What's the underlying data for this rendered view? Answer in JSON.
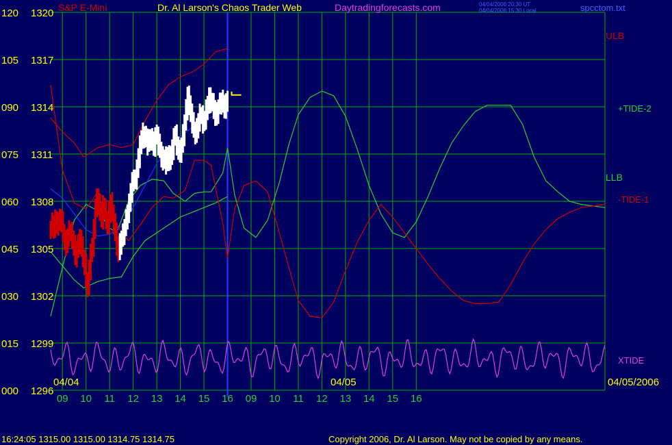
{
  "header": {
    "symbol": "S&P E-Mini",
    "title": "Dr. Al Larson's Chaos Trader Web",
    "site": "Daytradingforecasts.com",
    "timestamp_ut": "04/04/2006 20:30 UT",
    "timestamp_local": "04/04/2006 15:30 Local",
    "filename": "spcctom.txt"
  },
  "footer": {
    "quote": "16:24:05  1315.00 1315.00 1314.75 1314.75",
    "copyright": "Copyright 2006, Dr. Al Larson. May not be copied by any means."
  },
  "date_labels": {
    "left": "04/04",
    "middle": "04/05",
    "right": "04/05/2006"
  },
  "colors": {
    "background": "#000060",
    "grid": "#00b000",
    "yellow": "#ffff00",
    "red": "#d00000",
    "green": "#30d030",
    "magenta": "#e040e0",
    "blue": "#2030ff",
    "white": "#ffffff",
    "cursor": "#2040ff"
  },
  "chart_data": {
    "type": "line",
    "title": "S&P E-Mini",
    "ylim_price": [
      1296,
      1320
    ],
    "ylim_index": [
      0,
      120
    ],
    "y_ticks": [
      {
        "index": "000",
        "price": "1296"
      },
      {
        "index": "015",
        "price": "1299"
      },
      {
        "index": "030",
        "price": "1302"
      },
      {
        "index": "045",
        "price": "1305"
      },
      {
        "index": "060",
        "price": "1308"
      },
      {
        "index": "075",
        "price": "1311"
      },
      {
        "index": "090",
        "price": "1314"
      },
      {
        "index": "105",
        "price": "1317"
      },
      {
        "index": "120",
        "price": "1320"
      }
    ],
    "x_ticks": [
      "09",
      "10",
      "11",
      "12",
      "13",
      "14",
      "15",
      "16",
      "09",
      "10",
      "11",
      "12",
      "13",
      "14",
      "15",
      "16"
    ],
    "x_range": [
      8.5,
      32
    ],
    "series_labels": [
      "ULB",
      "+TIDE-2",
      "LLB",
      "-TIDE-1",
      "XTIDE"
    ],
    "series": [
      {
        "name": "ULB",
        "color": "red",
        "x": [
          8.5,
          9,
          9.5,
          9.9,
          10.5,
          11,
          11.5,
          12,
          12.5,
          13,
          13.5,
          14,
          14.5,
          15,
          15.5,
          16
        ],
        "y": [
          1313.3,
          1312.4,
          1311.7,
          1310.8,
          1311.4,
          1311.6,
          1311.4,
          1311.6,
          1313.1,
          1314.4,
          1315.4,
          1315.9,
          1316.2,
          1316.7,
          1317.5,
          1317.7
        ]
      },
      {
        "name": "LLB",
        "color": "green",
        "x": [
          8.5,
          9,
          9.5,
          9.9,
          10.5,
          11,
          11.5,
          12,
          12.5,
          13,
          13.5,
          14,
          14.5,
          15,
          15.5,
          16
        ],
        "y": [
          1304.8,
          1303.9,
          1303.0,
          1302.5,
          1302.9,
          1303.1,
          1303.2,
          1304.5,
          1305.5,
          1306.0,
          1306.5,
          1307.0,
          1307.3,
          1307.6,
          1307.9,
          1308.3
        ]
      },
      {
        "name": "+TIDE-2",
        "color": "green",
        "x": [
          8.5,
          9,
          9.5,
          10,
          10.5,
          11,
          11.3,
          11.8,
          12.3,
          12.8,
          13.3,
          13.7,
          14.2,
          14.6,
          15.0,
          15.3,
          15.8,
          16.0,
          16.3,
          16.7,
          17.2,
          17.7,
          18.2,
          18.6,
          19.0,
          19.5,
          20.0,
          20.5,
          21.0,
          21.5,
          22.0,
          22.5,
          23.0,
          23.5,
          24.0,
          24.5,
          25.0,
          25.5,
          26.0,
          26.5,
          27.0,
          27.5,
          28.0,
          28.5,
          29.0,
          29.5,
          30.0,
          30.5,
          31.0,
          31.5,
          32
        ],
        "y": [
          1300.7,
          1303.8,
          1306.8,
          1307.8,
          1307.4,
          1306.3,
          1306.0,
          1308.0,
          1309.0,
          1309.4,
          1309.3,
          1308.5,
          1308.0,
          1308.5,
          1308.6,
          1308.6,
          1309.8,
          1311.4,
          1308.4,
          1306.3,
          1305.7,
          1306.8,
          1309.2,
          1311.6,
          1313.5,
          1314.6,
          1315.0,
          1314.7,
          1313.4,
          1311.3,
          1309.0,
          1307.2,
          1306.0,
          1305.7,
          1306.7,
          1308.3,
          1310.1,
          1311.7,
          1312.8,
          1313.7,
          1314.1,
          1314.1,
          1314.1,
          1312.9,
          1310.8,
          1309.3,
          1308.6,
          1308.0,
          1307.8,
          1307.7,
          1307.6
        ]
      },
      {
        "name": "-TIDE-1",
        "color": "red",
        "x": [
          8.5,
          9,
          9.5,
          10,
          10.5,
          11,
          11.3,
          11.8,
          12.3,
          12.8,
          13.3,
          13.7,
          14.2,
          14.6,
          15.0,
          15.3,
          15.8,
          16.0,
          16.3,
          16.7,
          17.2,
          17.7,
          18.2,
          18.6,
          19.0,
          19.5,
          20.0,
          20.5,
          21.0,
          21.5,
          22.0,
          22.5,
          23.0,
          23.5,
          24.0,
          24.5,
          25.0,
          25.5,
          26.0,
          26.5,
          27.0,
          27.5,
          28.0,
          28.5,
          29.0,
          29.5,
          30.0,
          30.5,
          31.0,
          31.5,
          32
        ],
        "y": [
          1315.4,
          1310.0,
          1307.9,
          1307.5,
          1308.6,
          1307.9,
          1306.5,
          1305.5,
          1306.5,
          1307.6,
          1308.3,
          1308.2,
          1308.7,
          1310.6,
          1310.6,
          1310.3,
          1306.6,
          1304.4,
          1307.5,
          1309.0,
          1309.3,
          1308.6,
          1306.0,
          1303.8,
          1301.7,
          1300.7,
          1300.6,
          1301.6,
          1303.6,
          1305.4,
          1306.8,
          1307.8,
          1307.0,
          1306.0,
          1305.0,
          1304.0,
          1303.1,
          1302.3,
          1301.7,
          1301.5,
          1301.5,
          1301.6,
          1302.7,
          1304.1,
          1305.3,
          1306.2,
          1306.9,
          1307.3,
          1307.6,
          1307.7,
          1307.8
        ]
      },
      {
        "name": "center",
        "color": "blue",
        "x": [
          8.5,
          9,
          9.5,
          10,
          10.5,
          11,
          11.5,
          12,
          12.5,
          13,
          13.5,
          14,
          14.5,
          15,
          15.5,
          16
        ],
        "y": [
          1308.8,
          1308.2,
          1307.2,
          1306.2,
          1305.8,
          1305.9,
          1306.4,
          1307.6,
          1309.0,
          1310.4,
          1311.4,
          1312.1,
          1312.7,
          1313.1,
          1313.5,
          1313.9
        ]
      },
      {
        "name": "XTIDE",
        "color": "magenta",
        "x_start": 8.5,
        "x_end": 32,
        "level": 1298,
        "amplitude": 1.1
      }
    ],
    "price_bars": {
      "x_start": 8.5,
      "x_end": 16.0,
      "close": [
        1306.3,
        1306.6,
        1306.3,
        1306.8,
        1306.5,
        1306.6,
        1306.9,
        1306.7,
        1306.0,
        1305.5,
        1305.2,
        1305.8,
        1306.1,
        1306.0,
        1305.6,
        1305.2,
        1304.5,
        1304.9,
        1305.3,
        1305.6,
        1305.1,
        1304.4,
        1304.0,
        1303.0,
        1302.6,
        1303.6,
        1304.8,
        1305.0,
        1306.3,
        1307.5,
        1308.2,
        1307.8,
        1307.4,
        1306.9,
        1307.7,
        1307.3,
        1306.9,
        1306.5,
        1307.3,
        1307.9,
        1307.2,
        1306.6,
        1306.0,
        1305.2,
        1304.8,
        1305.3,
        1305.6,
        1305.9,
        1306.4,
        1306.8,
        1307.3,
        1307.8,
        1308.6,
        1309.2,
        1309.4,
        1309.4,
        1310.0,
        1310.8,
        1311.5,
        1312.0,
        1312.3,
        1312.0,
        1312.1,
        1311.6,
        1311.9,
        1312.0,
        1311.8,
        1311.5,
        1312.1,
        1312.2,
        1311.6,
        1311.3,
        1310.8,
        1310.6,
        1310.8,
        1310.4,
        1310.9,
        1310.6,
        1310.9,
        1311.3,
        1312.0,
        1312.2,
        1311.6,
        1311.2,
        1311.1,
        1311.6,
        1312.2,
        1313.0,
        1313.8,
        1314.7,
        1314.1,
        1313.6,
        1313.0,
        1312.5,
        1312.3,
        1312.6,
        1313.1,
        1313.5,
        1313.4,
        1313.0,
        1313.2,
        1313.8,
        1314.1,
        1314.6,
        1314.3,
        1314.2,
        1313.9,
        1313.4,
        1313.6,
        1314.0,
        1314.2,
        1314.4,
        1314.2,
        1313.9,
        1314.2,
        1314.4
      ],
      "color_up_to_x": 11.4,
      "last_tick": 1314.75
    },
    "cursor_x": 16.0,
    "grid": true
  }
}
